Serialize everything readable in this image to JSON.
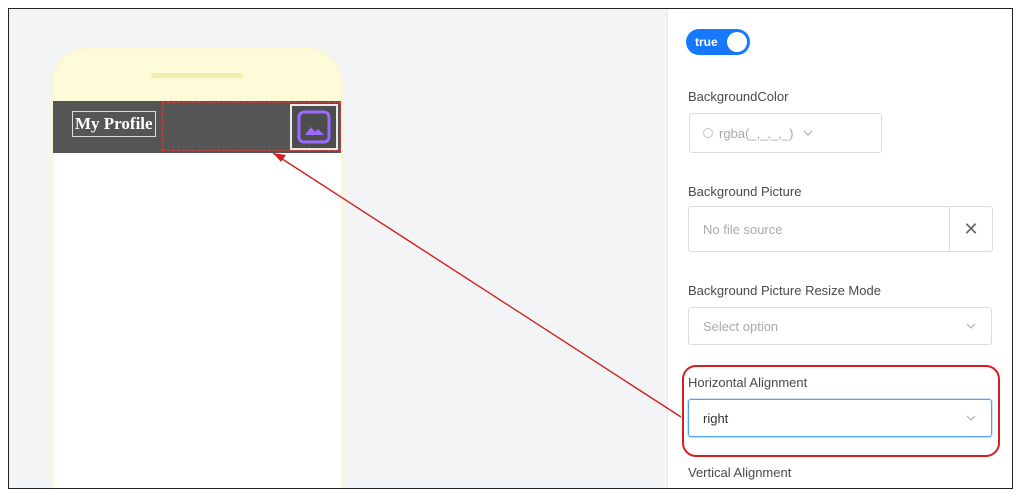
{
  "preview": {
    "appbar_title": "My Profile",
    "image_button_icon": "image-icon"
  },
  "properties": {
    "toggle_label": "true",
    "background_color": {
      "label": "BackgroundColor",
      "value": "rgba(_,_,_,_)"
    },
    "background_picture": {
      "label": "Background Picture",
      "placeholder": "No file source",
      "clear_glyph": "✕"
    },
    "resize_mode": {
      "label": "Background Picture Resize Mode",
      "placeholder": "Select option"
    },
    "horizontal_alignment": {
      "label": "Horizontal Alignment",
      "value": "right"
    },
    "vertical_alignment": {
      "label": "Vertical Alignment"
    }
  },
  "colors": {
    "accent": "#1677ff",
    "annotation": "#d22020",
    "appbar": "#555555",
    "image_icon": "#9b6bff"
  }
}
